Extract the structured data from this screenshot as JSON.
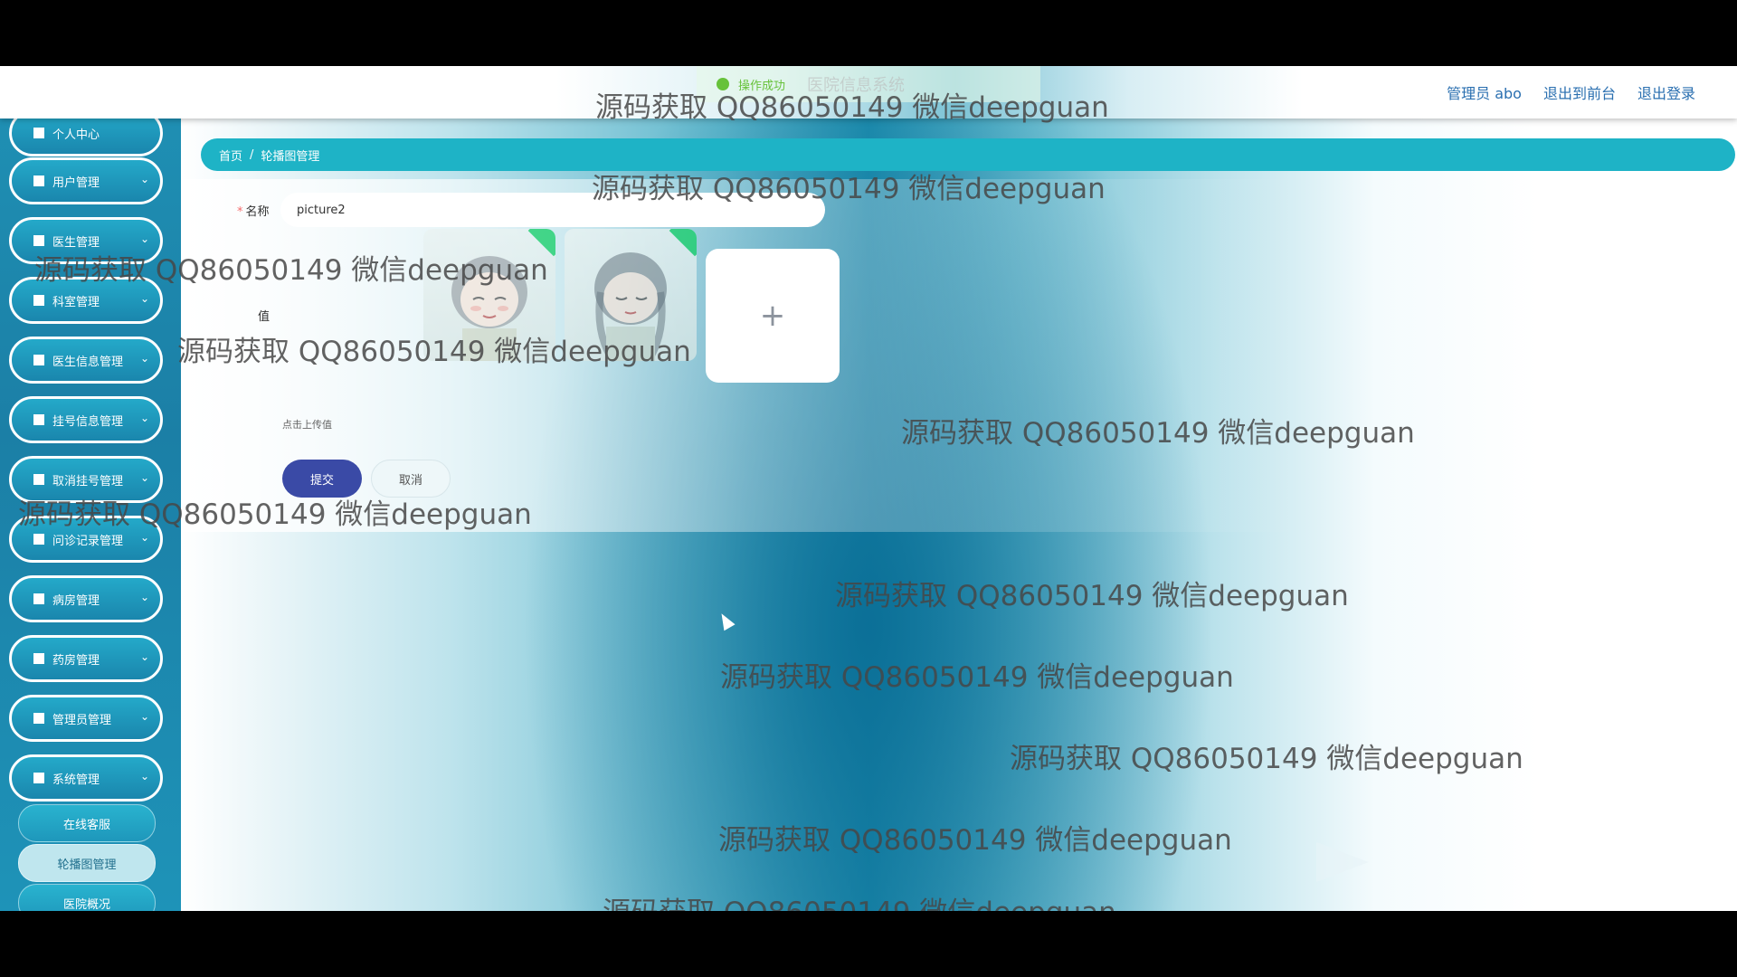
{
  "toast": {
    "text": "操作成功",
    "system_title": "医院信息系统"
  },
  "header": {
    "admin_label": "管理员 abo",
    "front_link": "退出到前台",
    "logout_link": "退出登录"
  },
  "sidebar": {
    "items": [
      {
        "label": "个人中心"
      },
      {
        "label": "用户管理"
      },
      {
        "label": "医生管理"
      },
      {
        "label": "科室管理"
      },
      {
        "label": "医生信息管理"
      },
      {
        "label": "挂号信息管理"
      },
      {
        "label": "取消挂号管理"
      },
      {
        "label": "问诊记录管理"
      },
      {
        "label": "病房管理"
      },
      {
        "label": "药房管理"
      },
      {
        "label": "管理员管理"
      },
      {
        "label": "系统管理"
      }
    ],
    "submenu": [
      {
        "label": "在线客服"
      },
      {
        "label": "轮播图管理"
      },
      {
        "label": "医院概况"
      }
    ]
  },
  "breadcrumb": {
    "home": "首页",
    "separator": "/",
    "current": "轮播图管理"
  },
  "form": {
    "name_label": "名称",
    "name_value": "picture2",
    "value_label": "值",
    "upload_hint": "点击上传值",
    "upload_plus": "+",
    "submit_label": "提交",
    "cancel_label": "取消"
  },
  "watermark": "源码获取 QQ86050149 微信deepguan",
  "colors": {
    "accent": "#1eb3c6",
    "submit": "#3a4aa6",
    "sidebar": "#1b7fa6",
    "success": "#67c23a"
  }
}
